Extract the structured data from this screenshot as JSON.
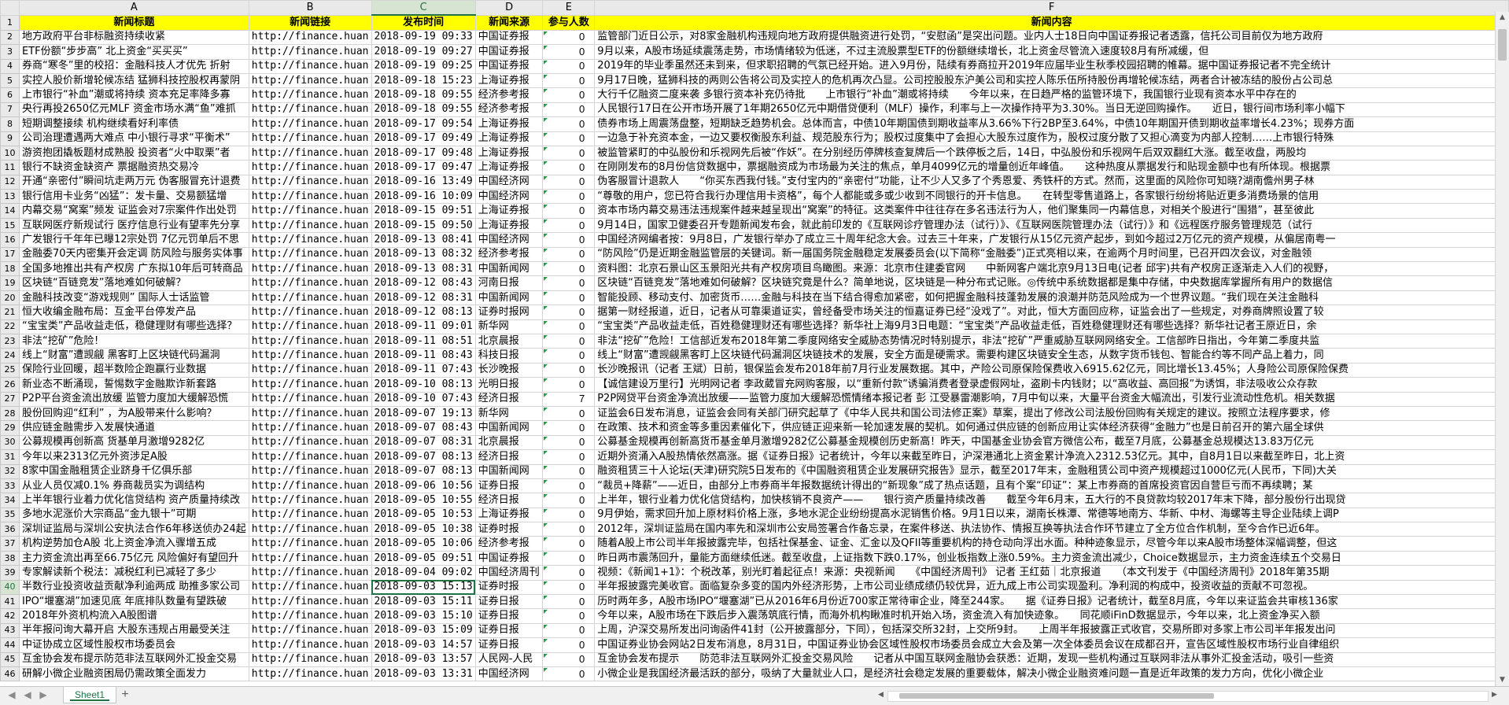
{
  "columns": [
    "A",
    "B",
    "C",
    "D",
    "E",
    "F"
  ],
  "headers": [
    "新闻标题",
    "新闻链接",
    "发布时间",
    "新闻来源",
    "参与人数",
    "新闻内容"
  ],
  "rows": [
    [
      "地方政府平台非标融资持续收紧",
      "http://finance.huan",
      "2018-09-19 09:33",
      "中国证券报",
      "0",
      "监管部门近日公示，对8家金融机构违规向地方政府提供融资进行处罚，“安慰函”是突出问题。业内人士18日向中国证券报记者透露，信托公司目前仅为地方政府"
    ],
    [
      "ETF份额“步步高” 北上资金“买买买”",
      "http://finance.huan",
      "2018-09-19 09:27",
      "中国证券报",
      "0",
      "9月以来，A股市场延续震荡走势，市场情绪较为低迷，不过主流股票型ETF的份额继续增长，北上资金尽管流入速度较8月有所减缓，但"
    ],
    [
      "券商“寒冬”里的校招：金融科技人才优先 折射",
      "http://finance.huan",
      "2018-09-19 09:25",
      "中国证券报",
      "0",
      "2019年的毕业季虽然还未到来，但求职招聘的气氛已经开始。进入9月份，陆续有券商拉开2019年应届毕业生秋季校园招聘的帷幕。据中国证券报记者不完全统计"
    ],
    [
      "实控人股价新增轮候冻结 猛狮科技控股权再蒙阴",
      "http://finance.huan",
      "2018-09-18 15:23",
      "上海证券报",
      "0",
      "9月17日晚，猛狮科技的两则公告将公司及实控人的危机再次凸显。公司控股股东沪美公司和实控人陈乐伍所持股份再增轮候冻结，两者合计被冻结的股份占公司总"
    ],
    [
      "上市银行“补血”潮或将持续 资本充足率降多寡",
      "http://finance.huan",
      "2018-09-18 09:55",
      "经济参考报",
      "0",
      "大行千亿融资二度来袭 多银行资本补充仍待批　　上市银行“补血”潮或将持续　　今年以来，在日趋严格的监管环境下，我国银行业现有资本水平中存在的"
    ],
    [
      "央行再投2650亿元MLF 资金市场水满“鱼”难抓",
      "http://finance.huan",
      "2018-09-18 09:55",
      "经济参考报",
      "0",
      "人民银行17日在公开市场开展了1年期2650亿元中期借贷便利（MLF）操作，利率与上一次操作持平为3.30%。当日无逆回购操作。　　近日，银行间市场利率小幅下"
    ],
    [
      "短期调整接续 机构继续看好利率债",
      "http://finance.huan",
      "2018-09-17 09:54",
      "上海证券报",
      "0",
      "债券市场上周震荡盘整，短期缺乏趋势机会。总体而言，中债10年期国债到期收益率从3.66%下行2BP至3.64%，中债10年期国开债到期收益率增长4.23%；现券方面"
    ],
    [
      "公司治理遭遇两大难点 中小银行寻求“平衡术”",
      "http://finance.huan",
      "2018-09-17 09:49",
      "上海证券报",
      "0",
      "一边急于补充资本金，一边又要权衡股东利益、规范股东行为；股权过度集中了会担心大股东过度作为，股权过度分散了又担心滴变为内部人控制……上市银行特殊"
    ],
    [
      "游资抱团撬板题材成熟股 投资者“火中取栗”者",
      "http://finance.huan",
      "2018-09-17 09:48",
      "上海证券报",
      "0",
      "被监管紧盯的中弘股份和乐视网先后被“作妖”。在分别经历停牌核查复牌后一个跌停板之后，14日，中弘股份和乐视网午后双双翻红大涨。截至收盘，两股均"
    ],
    [
      "银行不缺资金缺资产 票据融资热交易冷",
      "http://finance.huan",
      "2018-09-17 09:47",
      "上海证券报",
      "0",
      "在刚刚发布的8月份信贷数据中，票据融资成为市场最为关注的焦点，单月4099亿元的增量创近年峰值。　　这种热度从票据发行和贴现金额中也有所体现。根据票"
    ],
    [
      "开通“亲密付”瞬间坑走两万元 伪客服冒充计退费",
      "http://finance.huan",
      "2018-09-16 13:49",
      "中国经济网",
      "0",
      "伪客服冒计退款人　　“你买东西我付钱。”支付宝内的“亲密付”功能，让不少人又多了个秀恩爱、秀铁杆的方式。然而，这里面的风险你可知晓?湖南儋州男子林"
    ],
    [
      "银行信用卡业务“凶猛”：发卡量、交易额猛增",
      "http://finance.huan",
      "2018-09-16 10:09",
      "中国经济网",
      "0",
      "“尊敬的用户，您已符合我行办理信用卡资格”，每个人都能或多或少收到不同银行的开卡信息。　　在转型零售道路上，各家银行纷纷将贴近更多消费场景的信用"
    ],
    [
      "内幕交易“窝案”频发 证监会对7宗案件作出处罚",
      "http://finance.huan",
      "2018-09-15 09:51",
      "上海证券报",
      "0",
      "资本市场内幕交易违法违规案件越来越呈现出“窝案”的特征。这类案件中往往存在多名违法行为人，他们聚集同一内幕信息，对相关个股进行“围猎”，甚至彼此"
    ],
    [
      "互联网医疗新规试行 医疗信息行业有望率先分享",
      "http://finance.huan",
      "2018-09-15 09:50",
      "上海证券报",
      "0",
      "9月14日，国家卫健委召开专题新闻发布会，就此前印发的《互联网诊疗管理办法（试行）》、《互联网医院管理办法（试行）》和《远程医疗服务管理规范（试行"
    ],
    [
      "广发银行千年年已曝12宗处罚 7亿元罚单后不思",
      "http://finance.huan",
      "2018-09-13 08:41",
      "中国经济网",
      "0",
      "中国经济网编者按：9月8日，广发银行举办了成立三十周年纪念大会。过去三十年来，广发银行从15亿元资产起步，到如今超过2万亿元的资产规模，从偏居南粤一"
    ],
    [
      "金融委70天内密集开会定调 防风险与服务实体事",
      "http://finance.huan",
      "2018-09-13 08:32",
      "经济参考报",
      "0",
      "“防风险”仍是近期金融监管层的关键词。新一届国务院金融稳定发展委员会(以下简称“金融委”)正式亮相以来，在逾两个月时间里，已召开四次会议，对金融领"
    ],
    [
      "全国多地推出共有产权房 广东拟10年后可转商品",
      "http://finance.huan",
      "2018-09-13 08:31",
      "中国新闻网",
      "0",
      "资料图：北京石景山区玉景阳光共有产权房项目鸟瞰图。来源：北京市住建委官网　　中新网客户端北京9月13日电(记者 邱宇)共有产权房正逐渐走入人们的视野，"
    ],
    [
      "区块链“百链竞发”落地难如何破解？",
      "http://finance.huan",
      "2018-09-12 08:43",
      "河南日报",
      "0",
      "区块链“百链竞发”落地难如何破解？区块链究竟是什么？简单地说，区块链是一种分布式记账。◎传统中系统数据都是集中存储，中央数据库掌握所有用户的数据信"
    ],
    [
      "金融科技改变“游戏规则” 国际人士话监管",
      "http://finance.huan",
      "2018-09-12 08:31",
      "中国新闻网",
      "0",
      "智能投顾、移动支付、加密货币……金融与科技在当下结合得愈加紧密，如何把握金融科技蓬勃发展的浪潮并防范风险成为一个世界议题。“我们现在关注金融科"
    ],
    [
      "恒大收编金融布局：互金平台停发产品",
      "http://finance.huan",
      "2018-09-12 08:13",
      "证券时报网",
      "0",
      "据第一财经报道，近日，记者从可靠渠道证实，曾经备受市场关注的恒嘉证券已经“没戏了”。对此，恒大方面回应称，证监会出了一些规定，对券商牌照设置了较"
    ],
    [
      "“宝宝类”产品收益走低，稳健理财有哪些选择？",
      "http://finance.huan",
      "2018-09-11 09:01",
      "新华网",
      "0",
      "“宝宝类”产品收益走低，百姓稳健理财还有哪些选择？新华社上海9月3日电题：“宝宝类”产品收益走低，百姓稳健理财还有哪些选择？新华社记者王原近日，余"
    ],
    [
      "非法“挖矿”危险！",
      "http://finance.huan",
      "2018-09-11 08:51",
      "北京晨报",
      "0",
      "非法“挖矿”危险！工信部近发布2018年第二季度网络安全威胁态势情况时特别提示，非法“挖矿”严重威胁互联网网络安全。工信部昨日指出，今年第二季度共监"
    ],
    [
      "线上“财富”遭觊觎 黑客盯上区块链代码漏洞",
      "http://finance.huan",
      "2018-09-11 08:43",
      "科技日报",
      "0",
      "线上“财富”遭觊觎黑客盯上区块链代码漏洞区块链技术的发展，安全方面是硬需求。需要构建区块链安全生态，从数字货币钱包、智能合约等不同产品上着力，同"
    ],
    [
      "保险行业回暖，超半数险企跑赢行业数据",
      "http://finance.huan",
      "2018-09-11 07:43",
      "长沙晚报",
      "0",
      "长沙晚报讯（记者 王斌）日前，银保监会发布2018年前7月行业发展数据。其中，产险公司原保险保费收入6915.62亿元，同比增长13.45%；人身险公司原保险保费"
    ],
    [
      "新业态不断涌现，誓惕数字金融欺诈新套路",
      "http://finance.huan",
      "2018-09-10 08:13",
      "光明日报",
      "0",
      "【诚信建设万里行】光明网记者 李政葳冒充网购客服，以“重新付款”诱骗消费者登录虚假网址，盗刷卡内钱财；以“高收益、高回报”为诱饵，非法吸收公众存款"
    ],
    [
      "P2P平台资金流出放缓 监管力度加大缓解恐慌",
      "http://finance.huan",
      "2018-09-10 07:43",
      "经济日报",
      "7",
      "P2P网贷平台资金净流出放缓——监管力度加大缓解恐慌情绪本报记者 彭 江受暴雷潮影响，7月中旬以来，大量平台资金大幅流出，引发行业流动性危机。相关数据"
    ],
    [
      "股份回购迎“红利” ，为A股带来什么影响？",
      "http://finance.huan",
      "2018-09-07 19:13",
      "新华网",
      "0",
      "证监会6日发布消息，证监会会同有关部门研究起草了《中华人民共和国公司法修正案》草案，提出了修改公司法股份回购有关规定的建议。按照立法程序要求，修"
    ],
    [
      "供应链金融需步入发展快通道",
      "http://finance.huan",
      "2018-09-07 08:43",
      "中国新闻网",
      "0",
      "在政策、技术和资金等多重因素催化下，供应链正迎来新一轮加速发展的契机。如何通过供应链的创新应用让实体经济获得“金融力”也是日前召开的第六届全球供"
    ],
    [
      "公募规模再创新高 货基单月激增9282亿",
      "http://finance.huan",
      "2018-09-07 08:31",
      "北京晨报",
      "0",
      "公募基金规模再创新高货币基金单月激增9282亿公募基金规模创历史新高！昨天，中国基金业协会官方微信公布，截至7月底，公募基金总规模达13.83万亿元"
    ],
    [
      "今年以来2313亿元外资涉足A股",
      "http://finance.huan",
      "2018-09-07 08:13",
      "经济日报",
      "0",
      "近期外资涌入A股热情依然高涨。据《证券日报》记者统计，今年以来截至昨日，沪深港通北上资金累计净流入2312.53亿元。其中，自8月1日以来截至昨日，北上资"
    ],
    [
      "8家中国金融租赁企业跻身千亿俱乐部",
      "http://finance.huan",
      "2018-09-07 08:13",
      "中国新闻网",
      "0",
      "融资租赁三十人论坛(天津)研究院5日发布的《中国融资租赁企业发展研究报告》显示，截至2017年末，金融租赁公司中资产规模超过1000亿元(人民币，下同)大关"
    ],
    [
      "从业人员仅减0.1% 券商裁员实为调结构",
      "http://finance.huan",
      "2018-09-06 10:56",
      "证券日报",
      "0",
      "“裁员+降薪”——近日，由部分上市券商半年报数据统计得出的“新现象”成了热点话题，且有个案“印证”：某上市券商的首席投资官因自营巨亏而不再续聘；某"
    ],
    [
      "上半年银行业着力优化信贷结构 资产质量持续改",
      "http://finance.huan",
      "2018-09-05 10:55",
      "经济日报",
      "0",
      "上半年，银行业着力优化信贷结构，加快核销不良资产——　　银行资产质量持续改善　　截至今年6月末，五大行的不良贷款均较2017年末下降，部分股份行出现贷"
    ],
    [
      "多地水泥涨价大宗商品“金九银十”可期",
      "http://finance.huan",
      "2018-09-05 10:53",
      "上海证券报",
      "0",
      "9月伊始，需求回升加上原材料价格上涨，多地水泥企业纷纷提高水泥销售价格。9月1日以来，湖南长株潭、常德等地南方、华新、中材、海螺等主导企业陆续上调P"
    ],
    [
      "深圳证监局与深圳公安执法合作6年移送侦办24起",
      "http://finance.huan",
      "2018-09-05 10:38",
      "证券时报",
      "0",
      "2012年，深圳证监局在国内率先和深圳市公安局签署合作备忘录，在案件移送、执法协作、情报互换等执法合作环节建立了全方位合作机制，至今合作已近6年。"
    ],
    [
      "机构逆势加仓A股 北上资金净流入骤增五成",
      "http://finance.huan",
      "2018-09-05 10:06",
      "经济参考报",
      "0",
      "随着A股上市公司半年报披露完毕，包括社保基金、证金、汇金以及QFII等重要机构的持仓动向浮出水面。种种迹象显示，尽管今年以来A股市场整体深幅调整，但这"
    ],
    [
      "主力资金流出再至66.75亿元 风险偏好有望回升",
      "http://finance.huan",
      "2018-09-05 09:51",
      "中国证券报",
      "0",
      "昨日两市震荡回升，量能方面继续低迷。截至收盘，上证指数下跌0.17%，创业板指数上涨0.59%。主力资金流出减少，Choice数据显示，主力资金连续五个交易日"
    ],
    [
      "专家解读新个税法：减税红利已减轻了多少",
      "http://finance.huan",
      "2018-09-04 09:02",
      "中国经济周刊",
      "0",
      "视频：《新闻1+1》：个税改革，别光盯着起征点！来源：央视新闻　　《中国经济周刊》 记者 王红茹｜北京报道　　（本文刊发于《中国经济周刊》2018年第35期"
    ],
    [
      "半数行业投资收益贡献净利逾两成 助推多家公司",
      "http://finance.huan",
      "2018-09-03 15:13",
      "证券时报",
      "0",
      "半年报披露完美收官。面临复杂多变的国内外经济形势，上市公司业绩成绩仍较优异，近九成上市公司实现盈利。净利润的构成中，投资收益的贡献不可忽视。"
    ],
    [
      "IPO“堰塞湖”加速见底 年底排队数量有望跌破",
      "http://finance.huan",
      "2018-09-03 15:11",
      "证券日报",
      "0",
      "历时两年多，A股市场IPO“堰塞湖”已从2016年6月份近700家正常待审企业，降至244家。　　据《证券日报》记者统计，截至8月底，今年以来证监会共审核136家"
    ],
    [
      "2018年外资机构流入A股图谱",
      "http://finance.huan",
      "2018-09-03 15:10",
      "证券日报",
      "0",
      "今年以来，A股市场在下跌后步入震荡筑底行情，而海外机构瞅准时机开始入场，资金流入有加快迹象。　　同花顺iFinD数据显示，今年以来，北上资金净买入额"
    ],
    [
      "半年报问询大幕开启 大股东违规占用最受关注",
      "http://finance.huan",
      "2018-09-03 15:09",
      "证券日报",
      "0",
      "上周，沪深交易所发出问询函件41封（公开披露部分，下同），包括深交所32封，上交所9封。　　上周半年报披露正式收官，交易所即对多家上市公司半年报发出问"
    ],
    [
      "中证协成立区域性股权市场委员会",
      "http://finance.huan",
      "2018-09-03 14:57",
      "证券日报",
      "0",
      "中国证券业协会网站2日发布消息，8月31日，中国证券业协会区域性股权市场委员会成立大会及第一次全体委员会议在成都召开，宣告区域性股权市场行业自律组织"
    ],
    [
      "互金协会发布提示防范非法互联网外汇投金交易",
      "http://finance.huan",
      "2018-09-03 13:57",
      "人民网-人民",
      "0",
      "互金协会发布提示　　防范非法互联网外汇投金交易风险　　记者从中国互联网金融协会获悉：近期，发现一些机构通过互联网非法从事外汇投金活动，吸引一些资"
    ],
    [
      "研解小微企业融资困局仍需政策全面发力",
      "http://finance.huan",
      "2018-09-03 13:31",
      "中国经济网",
      "0",
      "小微企业是我国经济最活跃的部分，吸纳了大量就业人口，是经济社会稳定发展的重要载体，解决小微企业融资难问题一直是近年政策的发力方向，优化小微企业"
    ]
  ],
  "active_row": 40,
  "active_col": "C",
  "sheet_tab": "Sheet1"
}
